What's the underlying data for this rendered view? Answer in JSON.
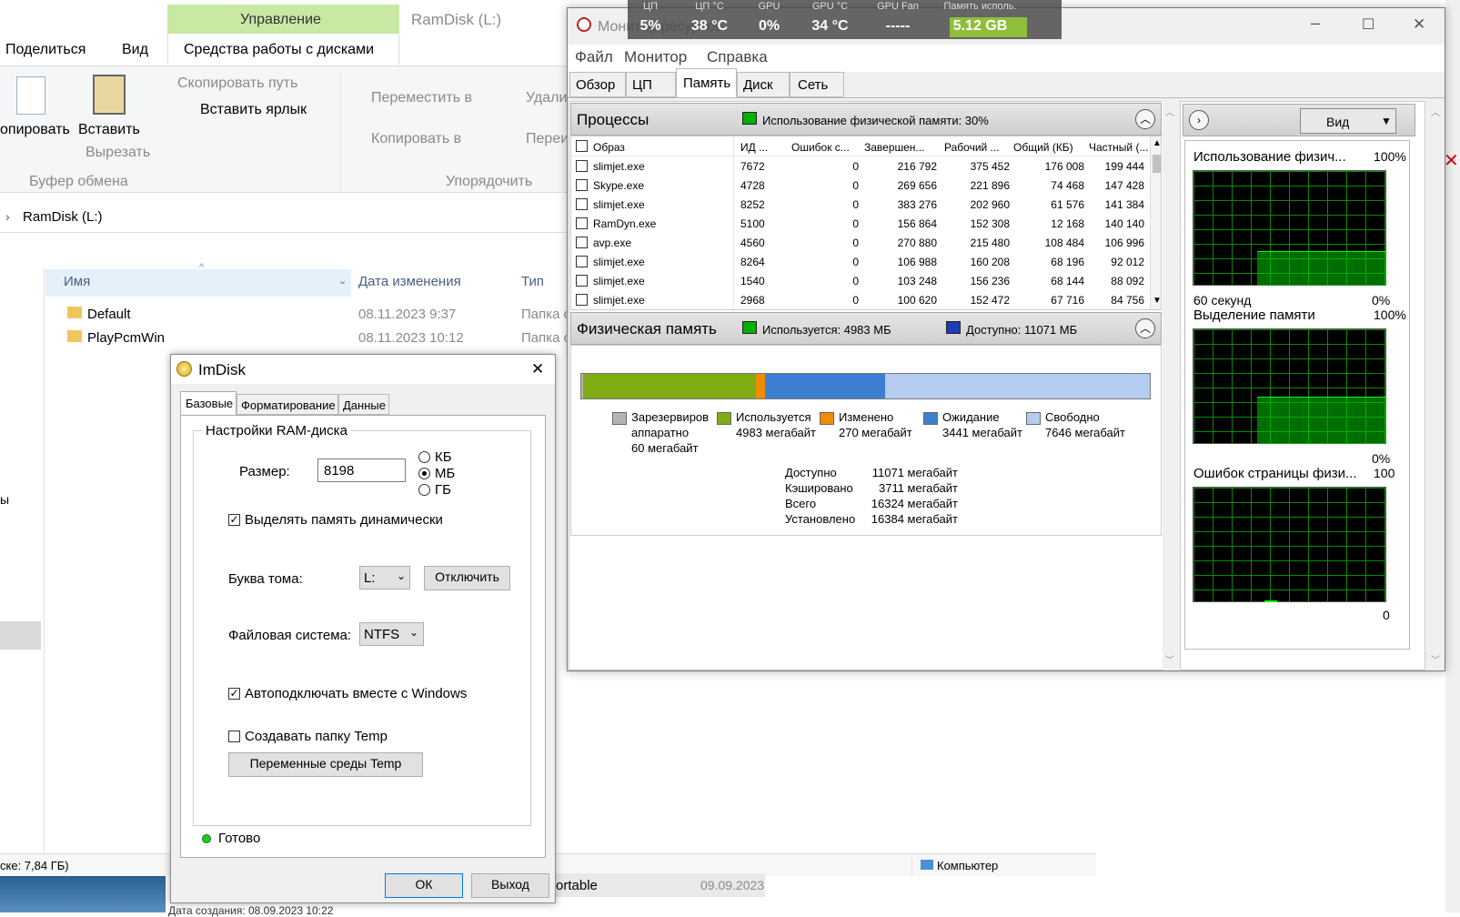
{
  "explorer": {
    "ribbon_tab_manage": "Управление",
    "window_title": "RamDisk (L:)",
    "tab_share": "Поделиться",
    "tab_view": "Вид",
    "tab_disk_tools": "Средства работы с дисками",
    "copy_path": "Скопировать путь",
    "paste_shortcut": "Вставить ярлык",
    "copy_label": "опировать",
    "paste_label": "Вставить",
    "cut_label": "Вырезать",
    "clipboard_group": "Буфер обмена",
    "move_to": "Переместить в",
    "copy_to": "Копировать в",
    "delete_label": "Удали",
    "rename_label": "Переи",
    "organize_group": "Упорядочить",
    "address": "RamDisk (L:)",
    "col_name": "Имя",
    "col_date": "Дата изменения",
    "col_type": "Тип",
    "files": [
      {
        "name": "Default",
        "date": "08.11.2023 9:37",
        "type": "Папка с"
      },
      {
        "name": "PlayPcmWin",
        "date": "08.11.2023 10:12",
        "type": "Папка с"
      }
    ],
    "left_fragment": "ы",
    "status_left": "ске: 7,84 ГБ)",
    "status_right": "Компьютер",
    "bottom_file": "ortable",
    "bottom_date": "09.09.2023",
    "bottom_created": "Дата создания: 08.09.2023 10:22"
  },
  "hwinfo": {
    "labels": [
      "ЦП",
      "ЦП °С",
      "GPU",
      "GPU °C",
      "GPU Fan",
      "Память исполь."
    ],
    "values": [
      "5%",
      "38 °C",
      "0%",
      "34 °C",
      "-----",
      "5.12 GB"
    ]
  },
  "imdisk": {
    "title": "ImDisk",
    "tabs": [
      "Базовые",
      "Форматирование",
      "Данные"
    ],
    "group_title": "Настройки RAM-диска",
    "size_label": "Размер:",
    "size_value": "8198",
    "unit_kb": "КБ",
    "unit_mb": "МБ",
    "unit_gb": "ГБ",
    "selected_unit": "МБ",
    "dynamic_label": "Выделять память динамически",
    "dynamic_checked": true,
    "drive_letter_label": "Буква тома:",
    "drive_letter_value": "L:",
    "unmount_button": "Отключить",
    "fs_label": "Файловая система:",
    "fs_value": "NTFS",
    "automount_label": "Автоподключать вместе с Windows",
    "automount_checked": true,
    "temp_label": "Создавать папку Temp",
    "temp_checked": false,
    "env_button": "Переменные среды Temp",
    "status": "Готово",
    "ok_button": "ОК",
    "exit_button": "Выход",
    "status_color": "#22cc22"
  },
  "resmon": {
    "title": "Монитор ресурсов",
    "menu": [
      "Файл",
      "Монитор",
      "Справка"
    ],
    "tabs": [
      "Обзор",
      "ЦП",
      "Память",
      "Диск",
      "Сеть"
    ],
    "active_tab": "Память",
    "processes": {
      "title": "Процессы",
      "usage_text": "Использование физической памяти: 30%",
      "columns": [
        "Образ",
        "ИД ...",
        "Ошибок с...",
        "Завершен...",
        "Рабочий ...",
        "Общий (КБ)",
        "Частный (..."
      ],
      "rows": [
        [
          "slimjet.exe",
          "7672",
          "0",
          "216 792",
          "375 452",
          "176 008",
          "199 444"
        ],
        [
          "Skype.exe",
          "4728",
          "0",
          "269 656",
          "221 896",
          "74 468",
          "147 428"
        ],
        [
          "slimjet.exe",
          "8252",
          "0",
          "383 276",
          "202 960",
          "61 576",
          "141 384"
        ],
        [
          "RamDyn.exe",
          "5100",
          "0",
          "156 864",
          "152 308",
          "12 168",
          "140 140"
        ],
        [
          "avp.exe",
          "4560",
          "0",
          "270 880",
          "215 480",
          "108 484",
          "106 996"
        ],
        [
          "slimjet.exe",
          "8264",
          "0",
          "106 988",
          "160 208",
          "68 196",
          "92 012"
        ],
        [
          "slimjet.exe",
          "1540",
          "0",
          "103 248",
          "156 236",
          "68 144",
          "88 092"
        ],
        [
          "slimjet.exe",
          "2968",
          "0",
          "100 620",
          "152 472",
          "67 716",
          "84 756"
        ]
      ]
    },
    "physical": {
      "title": "Физическая память",
      "in_use": "Используется: 4983 МБ",
      "available": "Доступно: 11071 МБ",
      "legend": [
        {
          "label": "Зарезервировано",
          "line1": "Зарезервиров",
          "line2": "аппаратно",
          "line3": "60 мегабайт",
          "color": "#b4b4b4"
        },
        {
          "line1": "Используется",
          "line2": "4983 мегабайт",
          "line3": "",
          "color": "#7fac12"
        },
        {
          "line1": "Изменено",
          "line2": "270 мегабайт",
          "line3": "",
          "color": "#f08c00"
        },
        {
          "line1": "Ожидание",
          "line2": "3441 мегабайт",
          "line3": "",
          "color": "#3f7fd2"
        },
        {
          "line1": "Свободно",
          "line2": "7646 мегабайт",
          "line3": "",
          "color": "#b4ccf0"
        }
      ],
      "bar_mb": {
        "reserved": 60,
        "in_use": 4983,
        "modified": 270,
        "standby": 3441,
        "free": 7646
      },
      "summary": [
        [
          "Доступно",
          "11071 мегабайт"
        ],
        [
          "Кэшировано",
          "3711 мегабайт"
        ],
        [
          "Всего",
          "16324 мегабайт"
        ],
        [
          "Установлено",
          "16384 мегабайт"
        ]
      ]
    },
    "graphs": {
      "view_button": "Вид",
      "g1_title": "Использование физич...",
      "g1_max": "100%",
      "g1_time": "60 секунд",
      "g1_min": "0%",
      "g2_title": "Выделение памяти",
      "g2_max": "100%",
      "g2_min": "0%",
      "g3_title": "Ошибок страницы физи...",
      "g3_max": "100",
      "g3_min": "0"
    }
  }
}
